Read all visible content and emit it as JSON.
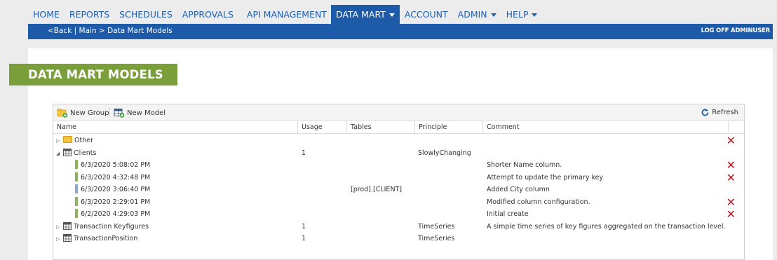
{
  "nav": {
    "items": [
      "HOME",
      "REPORTS",
      "SCHEDULES",
      "APPROVALS",
      "API MANAGEMENT",
      "DATA MART",
      "ACCOUNT",
      "ADMIN",
      "HELP"
    ]
  },
  "breadcrumb": {
    "back": "<Back",
    "sep1": " | ",
    "main": "Main",
    "sep2": " > ",
    "current": "Data Mart Models"
  },
  "logoff": "LOG OFF ADMINUSER",
  "page_title": "DATA MART MODELS",
  "toolbar": {
    "new_group": "New Group",
    "new_model": "New Model",
    "refresh": "Refresh"
  },
  "columns": {
    "name": "Name",
    "usage": "Usage",
    "tables": "Tables",
    "principle": "Principle",
    "comment": "Comment"
  },
  "rows": [
    {
      "name": "Other",
      "usage": "",
      "tables": "",
      "principle": "",
      "comment": ""
    },
    {
      "name": "Clients",
      "usage": "1",
      "tables": "",
      "principle": "SlowlyChanging",
      "comment": ""
    },
    {
      "name": "6/3/2020 5:08:02 PM",
      "usage": "",
      "tables": "",
      "principle": "",
      "comment": "Shorter Name column."
    },
    {
      "name": "6/3/2020 4:32:48 PM",
      "usage": "",
      "tables": "",
      "principle": "",
      "comment": "Attempt to update the primary key"
    },
    {
      "name": "6/3/2020 3:06:40 PM",
      "usage": "",
      "tables": "[prod].[CLIENT]",
      "principle": "",
      "comment": "Added City column"
    },
    {
      "name": "6/3/2020 2:29:01 PM",
      "usage": "",
      "tables": "",
      "principle": "",
      "comment": "Modified column configuration."
    },
    {
      "name": "6/2/2020 4:29:03 PM",
      "usage": "",
      "tables": "",
      "principle": "",
      "comment": "Initial create"
    },
    {
      "name": "Transaction Keyfigures",
      "usage": "1",
      "tables": "",
      "principle": "TimeSeries",
      "comment": "A simple time series of key figures aggregated on the transaction level."
    },
    {
      "name": "TransactionPosition",
      "usage": "1",
      "tables": "",
      "principle": "TimeSeries",
      "comment": ""
    }
  ],
  "delete_glyph": "✕",
  "colors": {
    "nav_blue": "#1d5ba8",
    "title_green": "#7a9e3a",
    "version_green": "#8db361",
    "version_blue": "#8fa7c7",
    "delete_red": "#c8141c"
  }
}
